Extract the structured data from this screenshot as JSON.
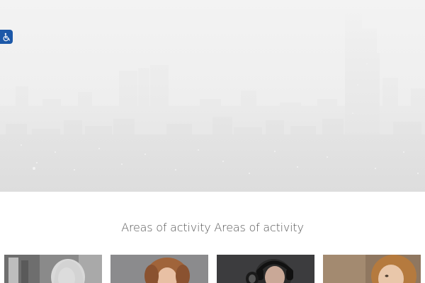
{
  "accessibility": {
    "icon": "wheelchair-icon",
    "color": "#1c58a8"
  },
  "hero": {
    "icon": "city-skyline-image"
  },
  "section": {
    "title": "Areas of activity Areas of activity"
  },
  "cards": [
    {
      "icon": "woman-portrait-bw-image"
    },
    {
      "icon": "woman-portrait-curly-hair-image"
    },
    {
      "icon": "woman-headphones-microphone-image"
    },
    {
      "icon": "woman-portrait-closeup-image"
    }
  ]
}
